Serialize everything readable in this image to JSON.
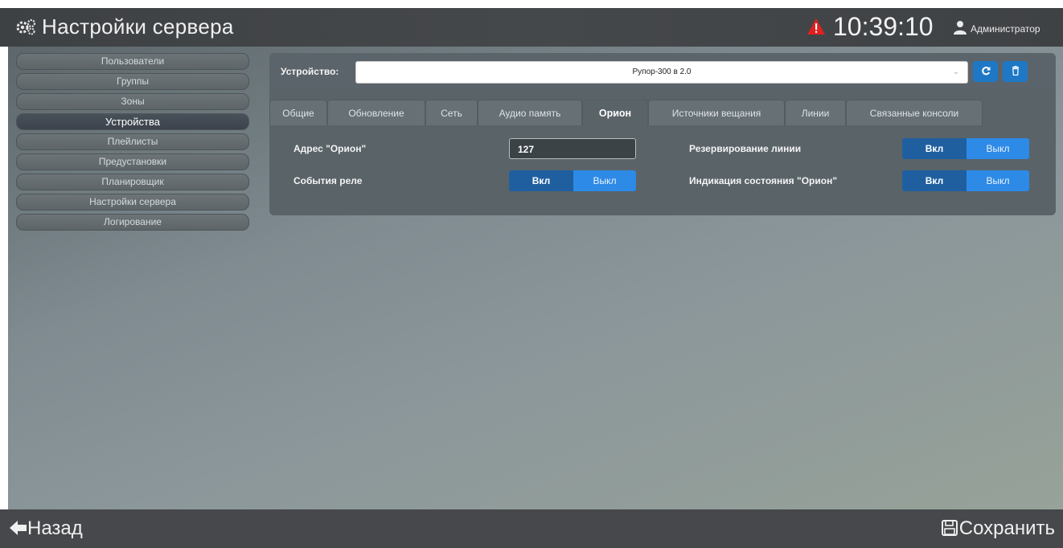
{
  "header": {
    "title": "Настройки сервера",
    "clock": "10:39:10",
    "user": "Администратор"
  },
  "sidebar": {
    "items": [
      {
        "label": "Пользователи"
      },
      {
        "label": "Группы"
      },
      {
        "label": "Зоны"
      },
      {
        "label": "Устройства",
        "active": true
      },
      {
        "label": "Плейлисты"
      },
      {
        "label": "Предустановки"
      },
      {
        "label": "Планировщик"
      },
      {
        "label": "Настройки сервера"
      },
      {
        "label": "Логирование"
      }
    ]
  },
  "device": {
    "label": "Устройство:",
    "selected": "Рупор-300 в 2.0"
  },
  "tabs": [
    {
      "label": "Общие"
    },
    {
      "label": "Обновление"
    },
    {
      "label": "Сеть"
    },
    {
      "label": "Аудио память"
    },
    {
      "label": "Орион",
      "active": true
    },
    {
      "label": "Источники вещания"
    },
    {
      "label": "Линии"
    },
    {
      "label": "Связанные консоли"
    }
  ],
  "orion": {
    "address_label": "Адрес \"Орион\"",
    "address_value": "127",
    "relay_label": "События реле",
    "reserve_label": "Резервирование линии",
    "indication_label": "Индикация состояния \"Орион\"",
    "on_label": "Вкл",
    "off_label": "Выкл"
  },
  "footer": {
    "back": "Назад",
    "save": "Сохранить"
  },
  "colors": {
    "accent": "#1f78c6",
    "toggle_on": "#1f5fa0",
    "toggle_off": "#2d8ae6",
    "alert": "#e02020"
  }
}
